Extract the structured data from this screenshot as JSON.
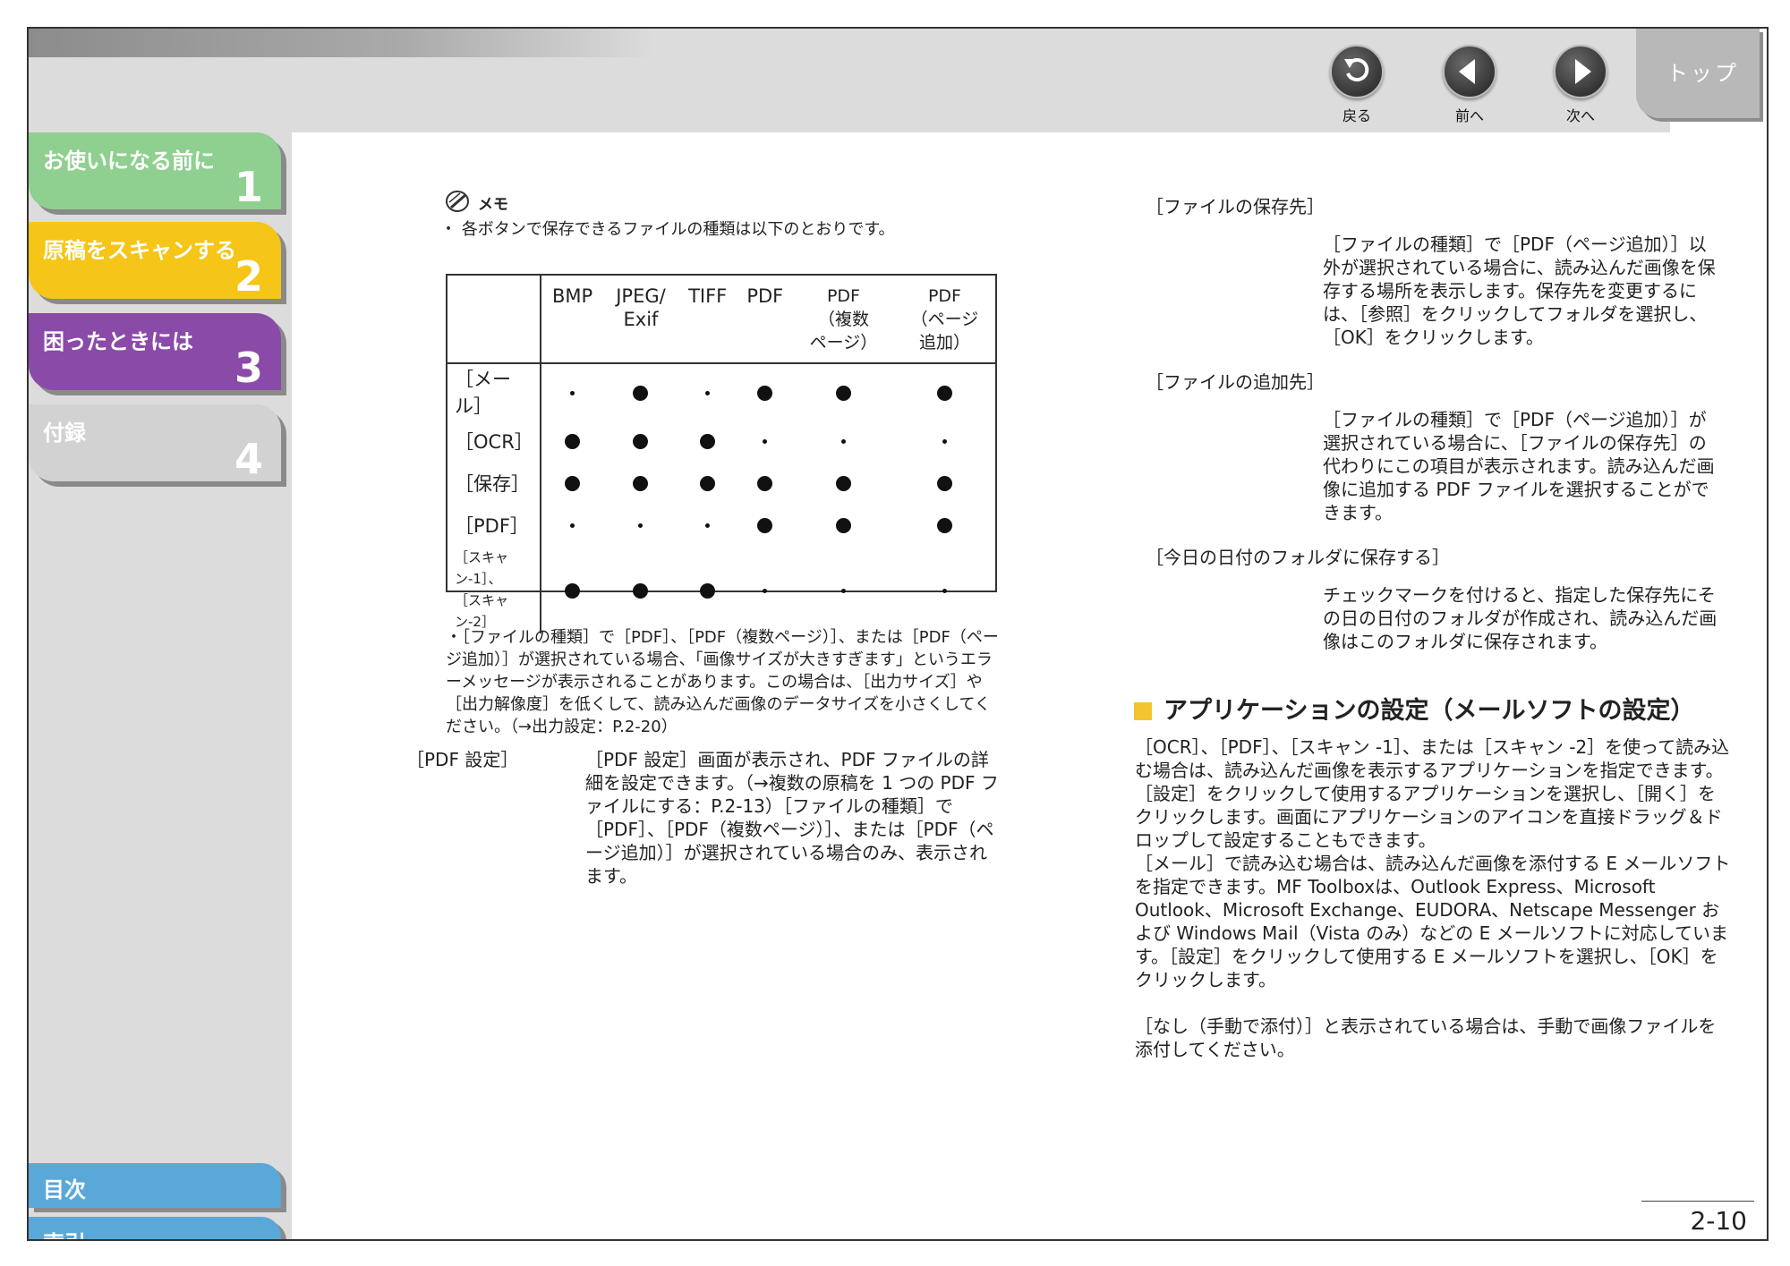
{
  "nav": {
    "back_label": "戻る",
    "prev_label": "前へ",
    "next_label": "次へ",
    "top_label": "トップ"
  },
  "sidebar": {
    "chapters": [
      {
        "title": "お使いになる前に",
        "number": "1",
        "color": "#8fcf8f"
      },
      {
        "title": "原稿をスキャンする",
        "number": "2",
        "color": "#f5c518"
      },
      {
        "title": "困ったときには",
        "number": "3",
        "color": "#8a4aa8"
      },
      {
        "title": "付録",
        "number": "4",
        "color": "#d2d2d2"
      }
    ],
    "contents_label": "目次",
    "index_label": "索引"
  },
  "memo": {
    "label": "メモ",
    "bullet1": "・ 各ボタンで保存できるファイルの種類は以下のとおりです。"
  },
  "table": {
    "headers": [
      "BMP",
      "JPEG/\nExif",
      "TIFF",
      "PDF",
      "PDF\n（複数\nページ）",
      "PDF\n（ページ\n追加）"
    ],
    "rows": [
      {
        "label": "［メール］",
        "cells": [
          "s",
          "b",
          "s",
          "b",
          "b",
          "b"
        ]
      },
      {
        "label": "［OCR］",
        "cells": [
          "b",
          "b",
          "b",
          "s",
          "s",
          "s"
        ]
      },
      {
        "label": "［保存］",
        "cells": [
          "b",
          "b",
          "b",
          "b",
          "b",
          "b"
        ]
      },
      {
        "label": "［PDF］",
        "cells": [
          "s",
          "s",
          "s",
          "b",
          "b",
          "b"
        ]
      },
      {
        "label": "［スキャン-1］、\n［スキャン-2］",
        "cells": [
          "b",
          "b",
          "b",
          "s",
          "s",
          "s"
        ]
      }
    ]
  },
  "memo_bullet2": "・［ファイルの種類］で［PDF］、［PDF（複数ページ）］、または［PDF（ページ追加）］が選択されている場合、「画像サイズが大きすぎます」というエラーメッセージが表示されることがあります。この場合は、［出力サイズ］や［出力解像度］を低くして、読み込んだ画像のデータサイズを小さくしてください。（→出力設定：P.2-20）",
  "pdf_setting": {
    "label": "［PDF 設定］",
    "text": "［PDF 設定］画面が表示され、PDF ファイルの詳細を設定できます。（→複数の原稿を 1 つの PDF ファイルにする：P.2-13）［ファイルの種類］で［PDF］、［PDF（複数ページ）］、または［PDF（ページ追加）］が選択されている場合のみ、表示されます。"
  },
  "right": {
    "save_dest_label": "［ファイルの保存先］",
    "save_dest_text": "［ファイルの種類］で［PDF（ページ追加）］以外が選択されている場合に、読み込んだ画像を保存する場所を表示します。保存先を変更するには、［参照］をクリックしてフォルダを選択し、［OK］をクリックします。",
    "append_dest_label": "［ファイルの追加先］",
    "append_dest_text": "［ファイルの種類］で［PDF（ページ追加）］が選択されている場合に、［ファイルの保存先］の代わりにこの項目が表示されます。読み込んだ画像に追加する PDF ファイルを選択することができます。",
    "today_folder_label": "［今日の日付のフォルダに保存する］",
    "today_folder_text": "チェックマークを付けると、指定した保存先にその日の日付のフォルダが作成され、読み込んだ画像はこのフォルダに保存されます。",
    "section_title": "アプリケーションの設定（メールソフトの設定）",
    "para1": "［OCR］、［PDF］、［スキャン -1］、または［スキャン -2］を使って読み込む場合は、読み込んだ画像を表示するアプリケーションを指定できます。［設定］をクリックして使用するアプリケーションを選択し、［開く］をクリックします。画面にアプリケーションのアイコンを直接ドラッグ＆ドロップして設定することもできます。",
    "para2": "［メール］で読み込む場合は、読み込んだ画像を添付する E メールソフトを指定できます。MF Toolboxは、Outlook Express、Microsoft Outlook、Microsoft Exchange、EUDORA、Netscape Messenger および Windows Mail（Vista のみ）などの E メールソフトに対応しています。［設定］をクリックして使用する E メールソフトを選択し、［OK］をクリックします。",
    "para3": "［なし（手動で添付）］と表示されている場合は、手動で画像ファイルを添付してください。"
  },
  "page_number": "2-10"
}
